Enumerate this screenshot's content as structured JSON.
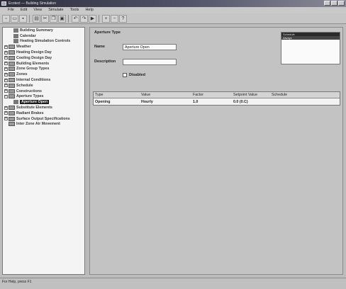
{
  "window": {
    "title": "Ecotect — Building Simulation"
  },
  "menu": [
    "File",
    "Edit",
    "View",
    "Simulate",
    "Tools",
    "Help"
  ],
  "toolbar": [
    "new-file",
    "open-folder",
    "save",
    "print",
    "cut",
    "copy",
    "paste",
    "undo",
    "redo",
    "run",
    "zoom-in",
    "zoom-out",
    "help"
  ],
  "tree": {
    "items": [
      {
        "label": "Building Summary",
        "level": 1,
        "expander": "",
        "icon": "leaf"
      },
      {
        "label": "Calendar",
        "level": 1,
        "expander": "",
        "icon": "leaf"
      },
      {
        "label": "Heating Simulation Controls",
        "level": 1,
        "expander": "",
        "icon": "leaf"
      },
      {
        "label": "Weather",
        "level": 0,
        "expander": "+",
        "icon": "folder"
      },
      {
        "label": "Heating Design Day",
        "level": 0,
        "expander": "+",
        "icon": "folder"
      },
      {
        "label": "Cooling Design Day",
        "level": 0,
        "expander": "+",
        "icon": "folder"
      },
      {
        "label": "Building Elements",
        "level": 0,
        "expander": "+",
        "icon": "folder"
      },
      {
        "label": "Zone Group Types",
        "level": 0,
        "expander": "+",
        "icon": "folder"
      },
      {
        "label": "Zones",
        "level": 0,
        "expander": "+",
        "icon": "folder"
      },
      {
        "label": "Internal Conditions",
        "level": 0,
        "expander": "+",
        "icon": "folder"
      },
      {
        "label": "Schedule",
        "level": 0,
        "expander": "+",
        "icon": "folder"
      },
      {
        "label": "Constructions",
        "level": 0,
        "expander": "+",
        "icon": "folder"
      },
      {
        "label": "Aperture Types",
        "level": 0,
        "expander": "−",
        "icon": "folder"
      },
      {
        "label": "Aperture Open",
        "level": 1,
        "expander": "",
        "icon": "leaf",
        "selected": true
      },
      {
        "label": "Substitute Elements",
        "level": 0,
        "expander": "+",
        "icon": "folder"
      },
      {
        "label": "Radiant Brakes",
        "level": 0,
        "expander": "+",
        "icon": "folder"
      },
      {
        "label": "Surface Output Specifications",
        "level": 0,
        "expander": "+",
        "icon": "folder"
      },
      {
        "label": "Inter Zone Air Movement",
        "level": 0,
        "expander": "",
        "icon": "folder"
      }
    ]
  },
  "form": {
    "section_title": "Aperture Type",
    "name_label": "Name",
    "name_value": "Aperture Open",
    "description_label": "Description",
    "description_value": "",
    "checkbox_label": "Disabled"
  },
  "listbox": {
    "header": "Schedule",
    "selected": "Always"
  },
  "grid": {
    "columns": [
      "Type",
      "Value",
      "Factor",
      "Setpoint Value",
      "Schedule"
    ],
    "rows": [
      [
        "Opening",
        "Hourly",
        "1.0",
        "0.0 (0.C)",
        ""
      ]
    ]
  },
  "status": {
    "text": "For Help, press F1"
  },
  "colors": {
    "selection": "#1c1c1c",
    "titlebar": "#2c2c3c"
  }
}
